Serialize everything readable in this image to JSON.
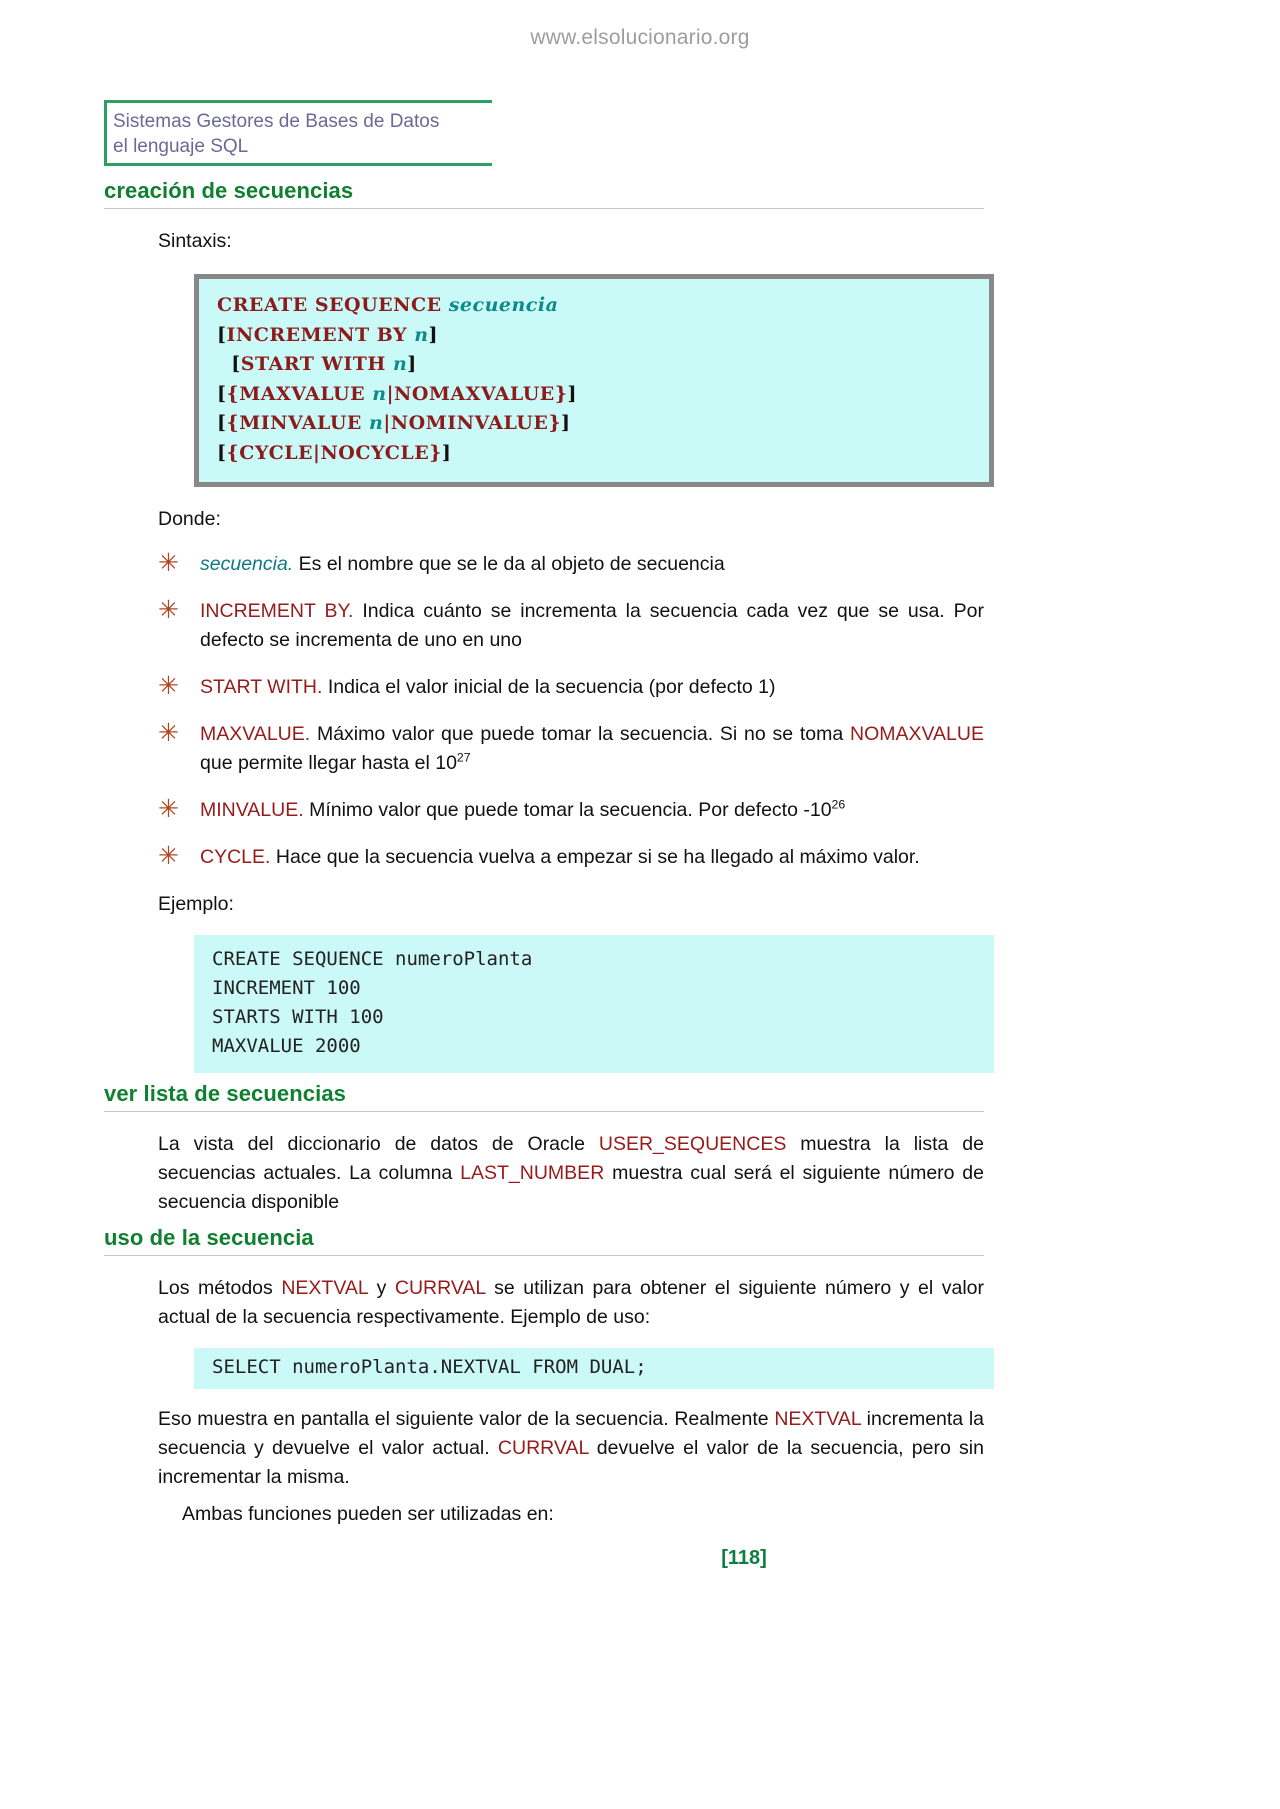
{
  "watermark": "www.elsolucionario.org",
  "header": {
    "line1": "Sistemas Gestores de Bases de Datos",
    "line2": "el lenguaje SQL"
  },
  "sections": {
    "creacion": {
      "heading": "creación de secuencias",
      "sintaxis_label": "Sintaxis:",
      "donde_label": "Donde:",
      "ejemplo_label": "Ejemplo:"
    },
    "ver_lista": {
      "heading": "ver lista de secuencias",
      "paragraph_part1": "La vista del diccionario de datos de Oracle ",
      "paragraph_kw1": "USER_SEQUENCES",
      "paragraph_part2": " muestra la lista de secuencias actuales. La columna ",
      "paragraph_kw2": "LAST_NUMBER",
      "paragraph_part3": " muestra cual será el siguiente número de secuencia disponible"
    },
    "uso": {
      "heading": "uso de la secuencia",
      "p1_part1": "Los métodos ",
      "p1_kw1": "NEXTVAL",
      "p1_part2": " y ",
      "p1_kw2": "CURRVAL",
      "p1_part3": " se utilizan para obtener el siguiente número y el valor actual de la secuencia respectivamente.  Ejemplo de uso:",
      "p2_part1": "Eso muestra en pantalla el siguiente valor de la secuencia. Realmente ",
      "p2_kw1": "NEXTVAL",
      "p2_part2": " incrementa la secuencia y devuelve el valor actual. ",
      "p2_kw2": "CURRVAL",
      "p2_part3": " devuelve el valor de la secuencia, pero sin incrementar la misma.",
      "p3": "Ambas funciones pueden ser utilizadas en:"
    }
  },
  "syntax_block": {
    "lines": [
      [
        {
          "t": "CREATE SEQUENCE ",
          "c": "kw"
        },
        {
          "t": "secuencia",
          "c": "var"
        }
      ],
      [
        {
          "t": "[",
          "c": "brk"
        },
        {
          "t": "INCREMENT BY ",
          "c": "kw"
        },
        {
          "t": "n",
          "c": "var"
        },
        {
          "t": "]",
          "c": "brk"
        }
      ],
      [
        {
          "t": "  [",
          "c": "brk"
        },
        {
          "t": "START WITH ",
          "c": "kw"
        },
        {
          "t": "n",
          "c": "var"
        },
        {
          "t": "]",
          "c": "brk"
        }
      ],
      [
        {
          "t": "[",
          "c": "brk"
        },
        {
          "t": "{MAXVALUE ",
          "c": "kw"
        },
        {
          "t": "n",
          "c": "var"
        },
        {
          "t": "|NOMAXVALUE}",
          "c": "kw"
        },
        {
          "t": "]",
          "c": "brk"
        }
      ],
      [
        {
          "t": "[",
          "c": "brk"
        },
        {
          "t": "{MINVALUE ",
          "c": "kw"
        },
        {
          "t": "n",
          "c": "var"
        },
        {
          "t": "|NOMINVALUE}",
          "c": "kw"
        },
        {
          "t": "]",
          "c": "brk"
        }
      ],
      [
        {
          "t": "[",
          "c": "brk"
        },
        {
          "t": "{CYCLE|NOCYCLE}",
          "c": "kw"
        },
        {
          "t": "]",
          "c": "brk"
        }
      ]
    ]
  },
  "bullets": [
    {
      "mark": "asterisk-bullet",
      "term": "secuencia.",
      "term_style": "var-it",
      "rest": " Es el nombre que se le da al objeto de secuencia",
      "justify": false
    },
    {
      "mark": "asterisk-bullet",
      "term": "INCREMENT BY.",
      "term_style": "kw",
      "rest": " Indica cuánto se incrementa la secuencia cada vez  que se usa. Por defecto se incrementa de uno en uno",
      "justify": true
    },
    {
      "mark": "asterisk-bullet",
      "term": "START WITH.",
      "term_style": "kw",
      "rest": " Indica el valor inicial de la secuencia (por defecto 1)",
      "justify": false
    },
    {
      "mark": "asterisk-bullet",
      "term": "MAXVALUE.",
      "term_style": "kw",
      "rest": " Máximo valor que puede tomar la secuencia. Si no se toma ",
      "rest_kw": "NOMAXVALUE",
      "rest2": " que permite llegar hasta el 10",
      "sup": "27",
      "justify": true
    },
    {
      "mark": "asterisk-bullet",
      "term": "MINVALUE.",
      "term_style": "kw",
      "rest": " Mínimo valor que puede tomar la secuencia. Por defecto -10",
      "sup": "26",
      "justify": false
    },
    {
      "mark": "asterisk-bullet",
      "term": "CYCLE.",
      "term_style": "kw",
      "rest": " Hace que la secuencia vuelva a empezar si se ha llegado al máximo valor.",
      "justify": false
    }
  ],
  "example_block": {
    "lines": [
      "CREATE SEQUENCE numeroPlanta",
      "INCREMENT 100",
      "STARTS WITH 100",
      "MAXVALUE 2000"
    ]
  },
  "select_block": {
    "line": "SELECT numeroPlanta.NEXTVAL FROM DUAL;"
  },
  "footer": {
    "page_number": "[118]"
  },
  "colors": {
    "heading_green": "#0e8030",
    "rule_green": "#2e9e62",
    "header_text": "#6a6a96",
    "keyword_red": "#961b1b",
    "code_keyword": "#8c1b1b",
    "code_var": "#0f8a8a",
    "code_bg": "#cafaf7",
    "code_frame": "#888888",
    "bullet": "#b0441f",
    "watermark": "#9d9d9d",
    "page_number": "#0f7d40"
  },
  "bullet_glyph": "✳"
}
